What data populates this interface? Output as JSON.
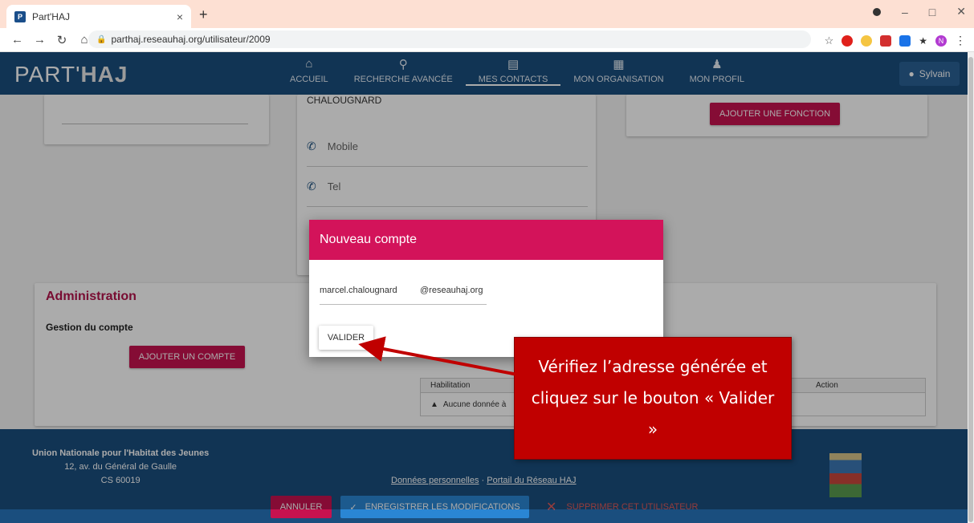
{
  "browser": {
    "tab_title": "Part'HAJ",
    "tab_favicon": "P",
    "tab_close": "×",
    "new_tab": "+",
    "url": "parthaj.reseauhaj.org/utilisateur/2009",
    "lock_icon": "lock-icon"
  },
  "header": {
    "logo_part": "PART'",
    "logo_haj": "HAJ",
    "nav": [
      {
        "label": "ACCUEIL",
        "icon": "home-icon"
      },
      {
        "label": "RECHERCHE AVANCÉE",
        "icon": "search-icon"
      },
      {
        "label": "MES CONTACTS",
        "icon": "contact-card-icon"
      },
      {
        "label": "MON ORGANISATION",
        "icon": "building-icon"
      },
      {
        "label": "MON PROFIL",
        "icon": "person-icon"
      }
    ],
    "user_name": "Sylvain"
  },
  "page": {
    "lastname_value": "CHALOUGNARD",
    "mobile_label": "Mobile",
    "tel_label": "Tel",
    "add_function_label": "AJOUTER UNE FONCTION",
    "admin_title": "Administration",
    "admin_subtitle": "Gestion du compte",
    "add_account_label": "AJOUTER UN COMPTE",
    "table_col_habilitation": "Habilitation",
    "table_col_action": "Action",
    "table_empty": "Aucune donnée à"
  },
  "modal": {
    "title": "Nouveau compte",
    "username": "marcel.chalougnard",
    "domain": "@reseauhaj.org",
    "validate_label": "VALIDER"
  },
  "callout": {
    "text": "Vérifiez l’adresse générée et cliquez sur le bouton « Valider »"
  },
  "footer": {
    "org_name": "Union Nationale pour l'Habitat des Jeunes",
    "address1": "12, av. du Général de Gaulle",
    "address2": "CS 60019",
    "link_personal_data": "Données personnelles",
    "link_separator": " · ",
    "link_portal": "Portail du Réseau HAJ"
  },
  "actions": {
    "cancel_label": "ANNULER",
    "save_label": "ENREGISTRER LES MODIFICATIONS",
    "delete_label": "SUPPRIMER CET UTILISATEUR"
  },
  "colors": {
    "header_blue": "#1a4e7e",
    "crimson": "#c7124f",
    "callout_red": "#c00000",
    "save_blue": "#2a86d4"
  }
}
